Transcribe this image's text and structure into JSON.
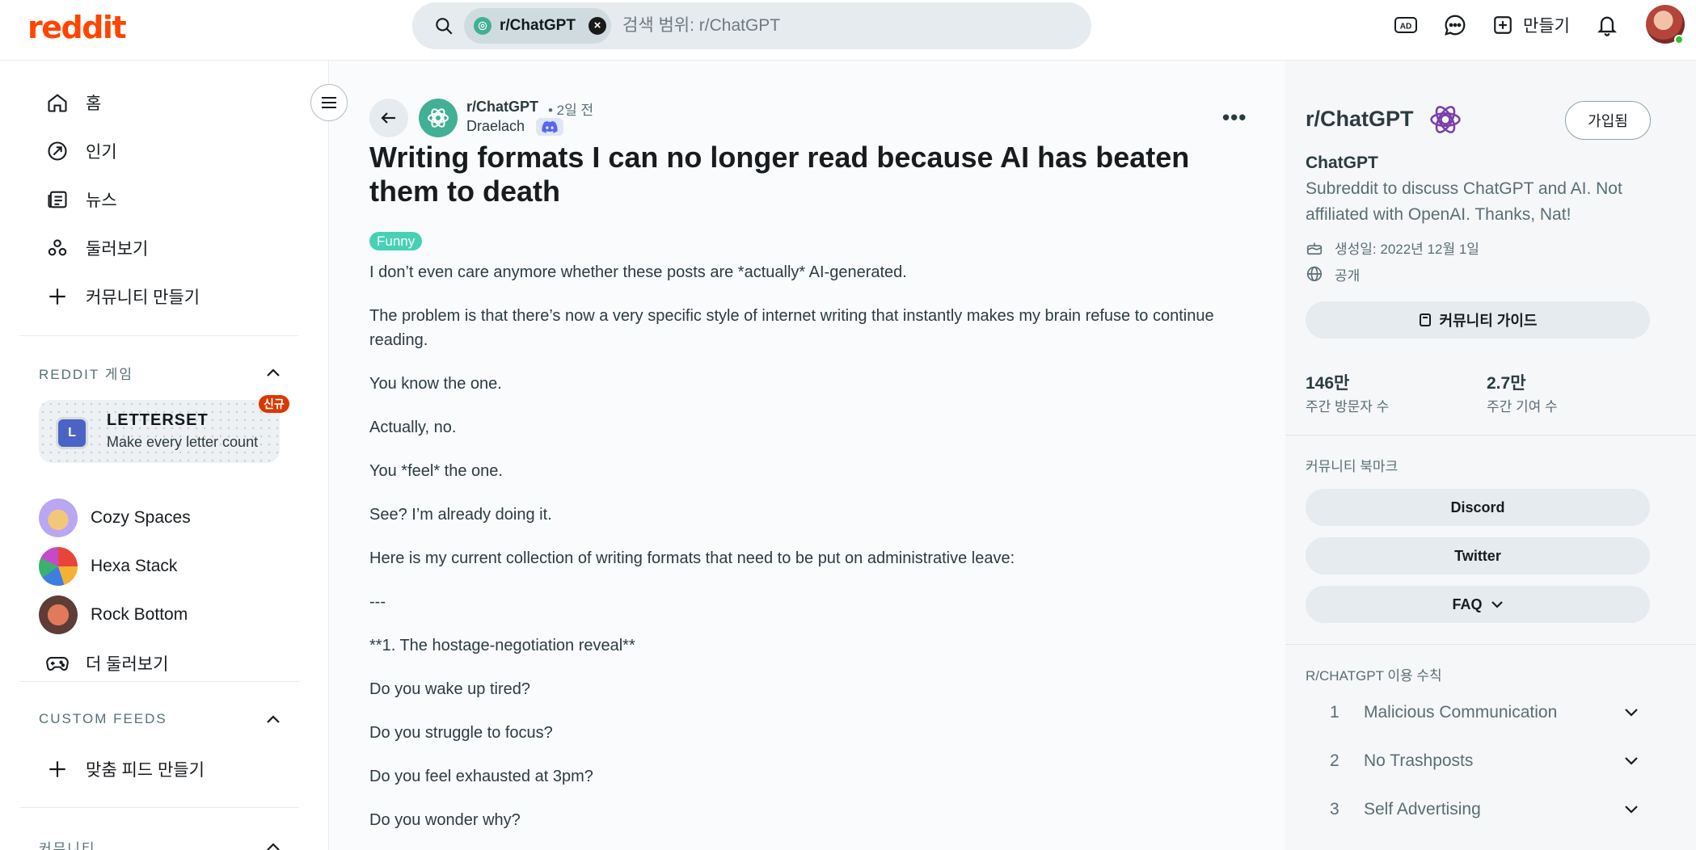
{
  "header": {
    "logo": "reddit",
    "search_chip": "r/ChatGPT",
    "search_placeholder": "검색 범위: r/ChatGPT",
    "create_label": "만들기"
  },
  "sidebar": {
    "nav": [
      {
        "label": "홈",
        "icon": "home-icon"
      },
      {
        "label": "인기",
        "icon": "popular-icon"
      },
      {
        "label": "뉴스",
        "icon": "news-icon"
      },
      {
        "label": "둘러보기",
        "icon": "explore-icon"
      },
      {
        "label": "커뮤니티 만들기",
        "icon": "plus-icon"
      }
    ],
    "games_header": "REDDIT 게임",
    "featured_game": {
      "tile": "L",
      "name": "LETTERSET",
      "desc": "Make every letter count",
      "badge": "신규"
    },
    "games": [
      {
        "name": "Cozy Spaces",
        "icon": "cozy-spaces-icon"
      },
      {
        "name": "Hexa Stack",
        "icon": "hexa-stack-icon"
      },
      {
        "name": "Rock Bottom",
        "icon": "rock-bottom-icon"
      }
    ],
    "more_games": "더 둘러보기",
    "custom_feeds_header": "CUSTOM FEEDS",
    "create_feed": "맞춤 피드 만들기",
    "communities_header": "커뮤니티"
  },
  "post": {
    "subreddit": "r/ChatGPT",
    "time": "• 2일 전",
    "author": "Draelach",
    "title": "Writing formats I can no longer read because AI has beaten them to death",
    "flair": "Funny",
    "flair_color": "#46d1b5",
    "body": [
      "I don’t even care anymore whether these posts are *actually* AI-generated.",
      "The problem is that there’s now a very specific style of internet writing that instantly makes my brain refuse to continue reading.",
      "You know the one.",
      "Actually, no.",
      "You *feel* the one.",
      "See? I’m already doing it.",
      "Here is my current collection of writing formats that need to be put on administrative leave:",
      "---",
      "**1. The hostage-negotiation reveal**",
      "Do you wake up tired?",
      "Do you struggle to focus?",
      "Do you feel exhausted at 3pm?",
      "Do you wonder why?"
    ]
  },
  "community": {
    "title": "r/ChatGPT",
    "join_label": "가입됨",
    "name": "ChatGPT",
    "description": "Subreddit to discuss ChatGPT and AI. Not affiliated with OpenAI. Thanks, Nat!",
    "created": "생성일: 2022년 12월 1일",
    "visibility": "공개",
    "guide_label": "커뮤니티 가이드",
    "stats": [
      {
        "value": "146만",
        "label": "주간 방문자 수"
      },
      {
        "value": "2.7만",
        "label": "주간 기여 수"
      }
    ],
    "bookmarks_header": "커뮤니티 북마크",
    "bookmarks": [
      "Discord",
      "Twitter",
      "FAQ"
    ],
    "rules_header": "R/CHATGPT 이용 수칙",
    "rules": [
      {
        "num": "1",
        "title": "Malicious Communication"
      },
      {
        "num": "2",
        "title": "No Trashposts"
      },
      {
        "num": "3",
        "title": "Self Advertising"
      }
    ]
  },
  "colors": {
    "brand": "#ff4500",
    "subreddit": "#41b095",
    "badge_new": "#d93900"
  }
}
